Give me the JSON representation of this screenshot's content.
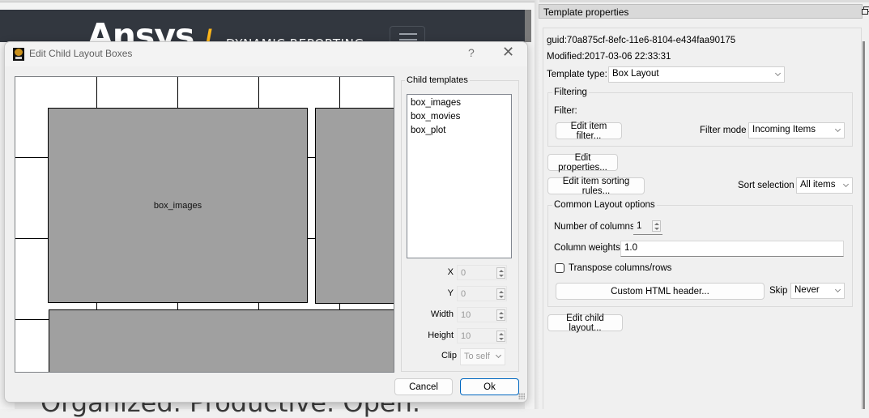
{
  "background_page": {
    "brand_logo": "Ansys",
    "brand_separator": "/",
    "brand_product": "DYNAMIC REPORTING",
    "tagline": "Organized. Productive. Open."
  },
  "dialog": {
    "title": "Edit Child Layout Boxes",
    "help_label": "?",
    "close_label": "✕",
    "canvas": {
      "boxes": [
        {
          "name": "box_images",
          "label": "box_images"
        },
        {
          "name": "box_movies",
          "label": ""
        },
        {
          "name": "box_plot",
          "label": ""
        }
      ]
    },
    "child_templates": {
      "label": "Child templates",
      "items": [
        "box_images",
        "box_movies",
        "box_plot"
      ]
    },
    "properties": {
      "x": {
        "label": "X",
        "value": "0"
      },
      "y": {
        "label": "Y",
        "value": "0"
      },
      "width": {
        "label": "Width",
        "value": "10"
      },
      "height": {
        "label": "Height",
        "value": "10"
      },
      "clip": {
        "label": "Clip",
        "value": "To self"
      }
    },
    "buttons": {
      "cancel": "Cancel",
      "ok": "Ok"
    }
  },
  "template_properties": {
    "title": "Template properties",
    "guid": "guid:70a875cf-8efc-11e6-8104-e434faa90175",
    "modified": "Modified:2017-03-06 22:33:31",
    "template_type_label": "Template type:",
    "template_type_value": "Box Layout",
    "filtering": {
      "group_label": "Filtering",
      "filter_label": "Filter:",
      "edit_filter_button": "Edit item filter...",
      "filter_mode_label": "Filter mode",
      "filter_mode_value": "Incoming Items"
    },
    "edit_properties_button": "Edit properties...",
    "edit_sorting_button": "Edit item sorting rules...",
    "sort_selection_label": "Sort selection",
    "sort_selection_value": "All items",
    "common_layout": {
      "group_label": "Common Layout options",
      "num_columns_label": "Number of columns",
      "num_columns_value": "1",
      "column_weights_label": "Column weights",
      "column_weights_value": "1.0",
      "transpose_label": "Transpose columns/rows",
      "transpose_checked": false,
      "custom_html_button": "Custom HTML header...",
      "skip_label": "Skip",
      "skip_value": "Never"
    },
    "edit_child_layout_button": "Edit child layout..."
  }
}
